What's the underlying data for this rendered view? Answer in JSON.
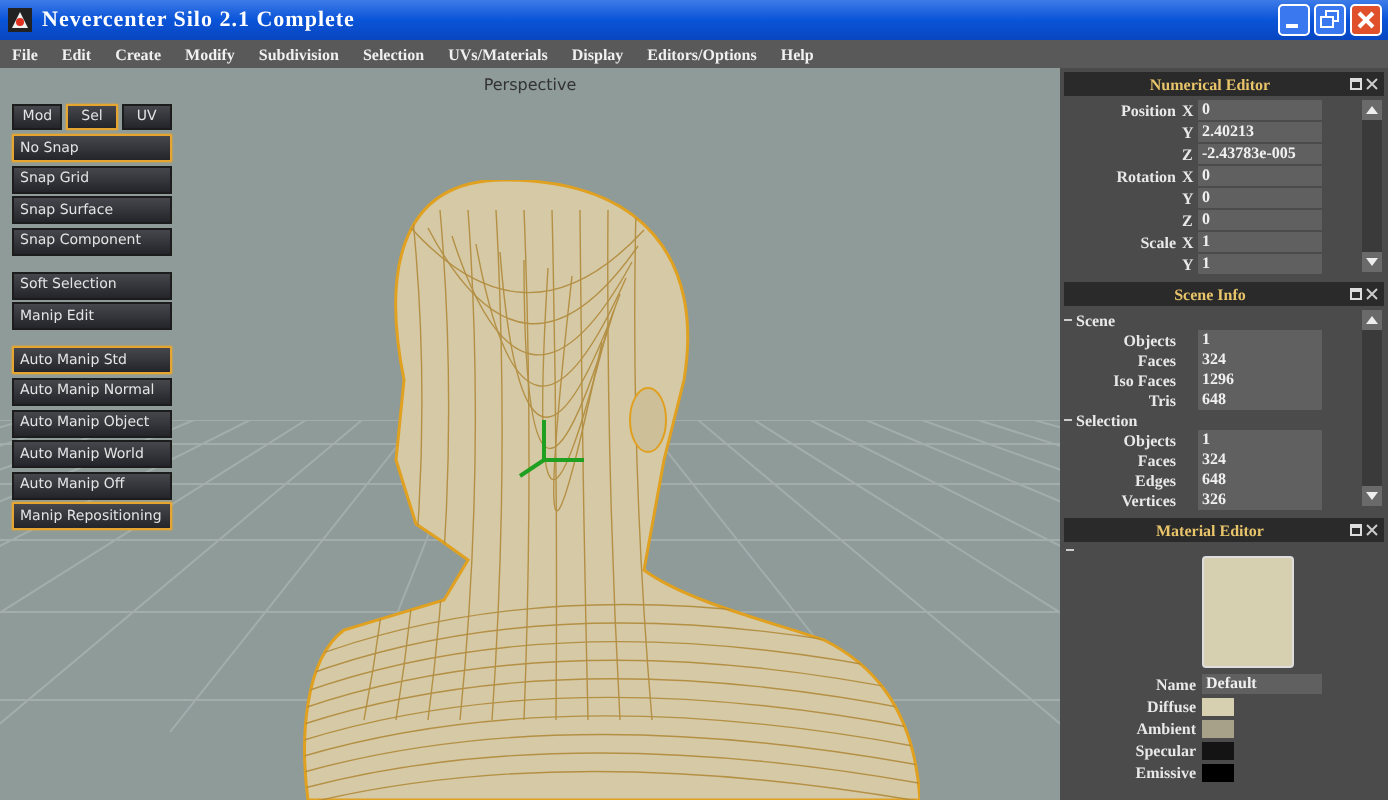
{
  "window": {
    "title": "Nevercenter Silo 2.1 Complete"
  },
  "menu": [
    "File",
    "Edit",
    "Create",
    "Modify",
    "Subdivision",
    "Selection",
    "UVs/Materials",
    "Display",
    "Editors/Options",
    "Help"
  ],
  "mode_tabs": [
    {
      "label": "Mod",
      "selected": false
    },
    {
      "label": "Sel",
      "selected": true
    },
    {
      "label": "UV",
      "selected": false
    }
  ],
  "tool_groups": [
    [
      {
        "label": "No Snap",
        "selected": true
      },
      {
        "label": "Snap Grid",
        "selected": false
      },
      {
        "label": "Snap Surface",
        "selected": false
      },
      {
        "label": "Snap Component",
        "selected": false
      }
    ],
    [
      {
        "label": "Soft Selection",
        "selected": false
      },
      {
        "label": "Manip Edit",
        "selected": false
      }
    ],
    [
      {
        "label": "Auto Manip Std",
        "selected": true
      },
      {
        "label": "Auto Manip Normal",
        "selected": false
      },
      {
        "label": "Auto Manip Object",
        "selected": false
      },
      {
        "label": "Auto Manip World",
        "selected": false
      },
      {
        "label": "Auto Manip Off",
        "selected": false
      },
      {
        "label": "Manip Repositioning",
        "selected": true
      }
    ]
  ],
  "viewport": {
    "title": "Perspective"
  },
  "numerical_editor": {
    "title": "Numerical Editor",
    "rows": [
      {
        "label": "Position",
        "axis": "X",
        "value": "0"
      },
      {
        "axis": "Y",
        "value": "2.40213"
      },
      {
        "axis": "Z",
        "value": "-2.43783e-005"
      },
      {
        "label": "Rotation",
        "axis": "X",
        "value": "0"
      },
      {
        "axis": "Y",
        "value": "0"
      },
      {
        "axis": "Z",
        "value": "0"
      },
      {
        "label": "Scale",
        "axis": "X",
        "value": "1"
      },
      {
        "axis": "Y",
        "value": "1"
      }
    ]
  },
  "scene_info": {
    "title": "Scene Info",
    "sections": [
      {
        "heading": "Scene",
        "rows": [
          {
            "label": "Objects",
            "value": "1"
          },
          {
            "label": "Faces",
            "value": "324"
          },
          {
            "label": "Iso Faces",
            "value": "1296"
          },
          {
            "label": "Tris",
            "value": "648"
          }
        ]
      },
      {
        "heading": "Selection",
        "rows": [
          {
            "label": "Objects",
            "value": "1"
          },
          {
            "label": "Faces",
            "value": "324"
          },
          {
            "label": "Edges",
            "value": "648"
          },
          {
            "label": "Vertices",
            "value": "326"
          }
        ]
      }
    ]
  },
  "material_editor": {
    "title": "Material Editor",
    "name_label": "Name",
    "name": "Default",
    "colors": [
      {
        "label": "Diffuse",
        "color": "#d6cfb0"
      },
      {
        "label": "Ambient",
        "color": "#a8a18a"
      },
      {
        "label": "Specular",
        "color": "#141414"
      },
      {
        "label": "Emissive",
        "color": "#000000"
      }
    ]
  }
}
